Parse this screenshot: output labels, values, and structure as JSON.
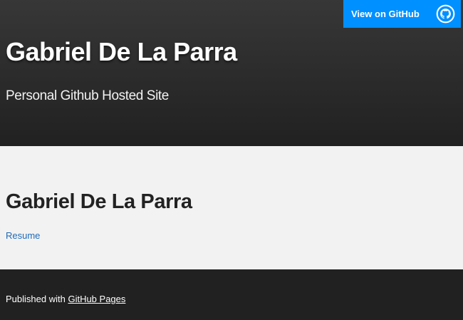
{
  "header": {
    "site_title": "Gabriel De La Parra",
    "tagline": "Personal Github Hosted Site",
    "github_button": {
      "label": "View on GitHub",
      "icon": "github-octocat-icon",
      "background": "#0090ff"
    }
  },
  "main": {
    "title": "Gabriel De La Parra",
    "links": [
      {
        "label": "Resume"
      }
    ],
    "link_color": "#1e6bb8"
  },
  "footer": {
    "prefix": "Published with",
    "link_label": "GitHub Pages"
  },
  "colors": {
    "header_top": "#373737",
    "header_bottom": "#212121",
    "main_bg": "#f2f2f2",
    "footer_bg": "#212121"
  }
}
